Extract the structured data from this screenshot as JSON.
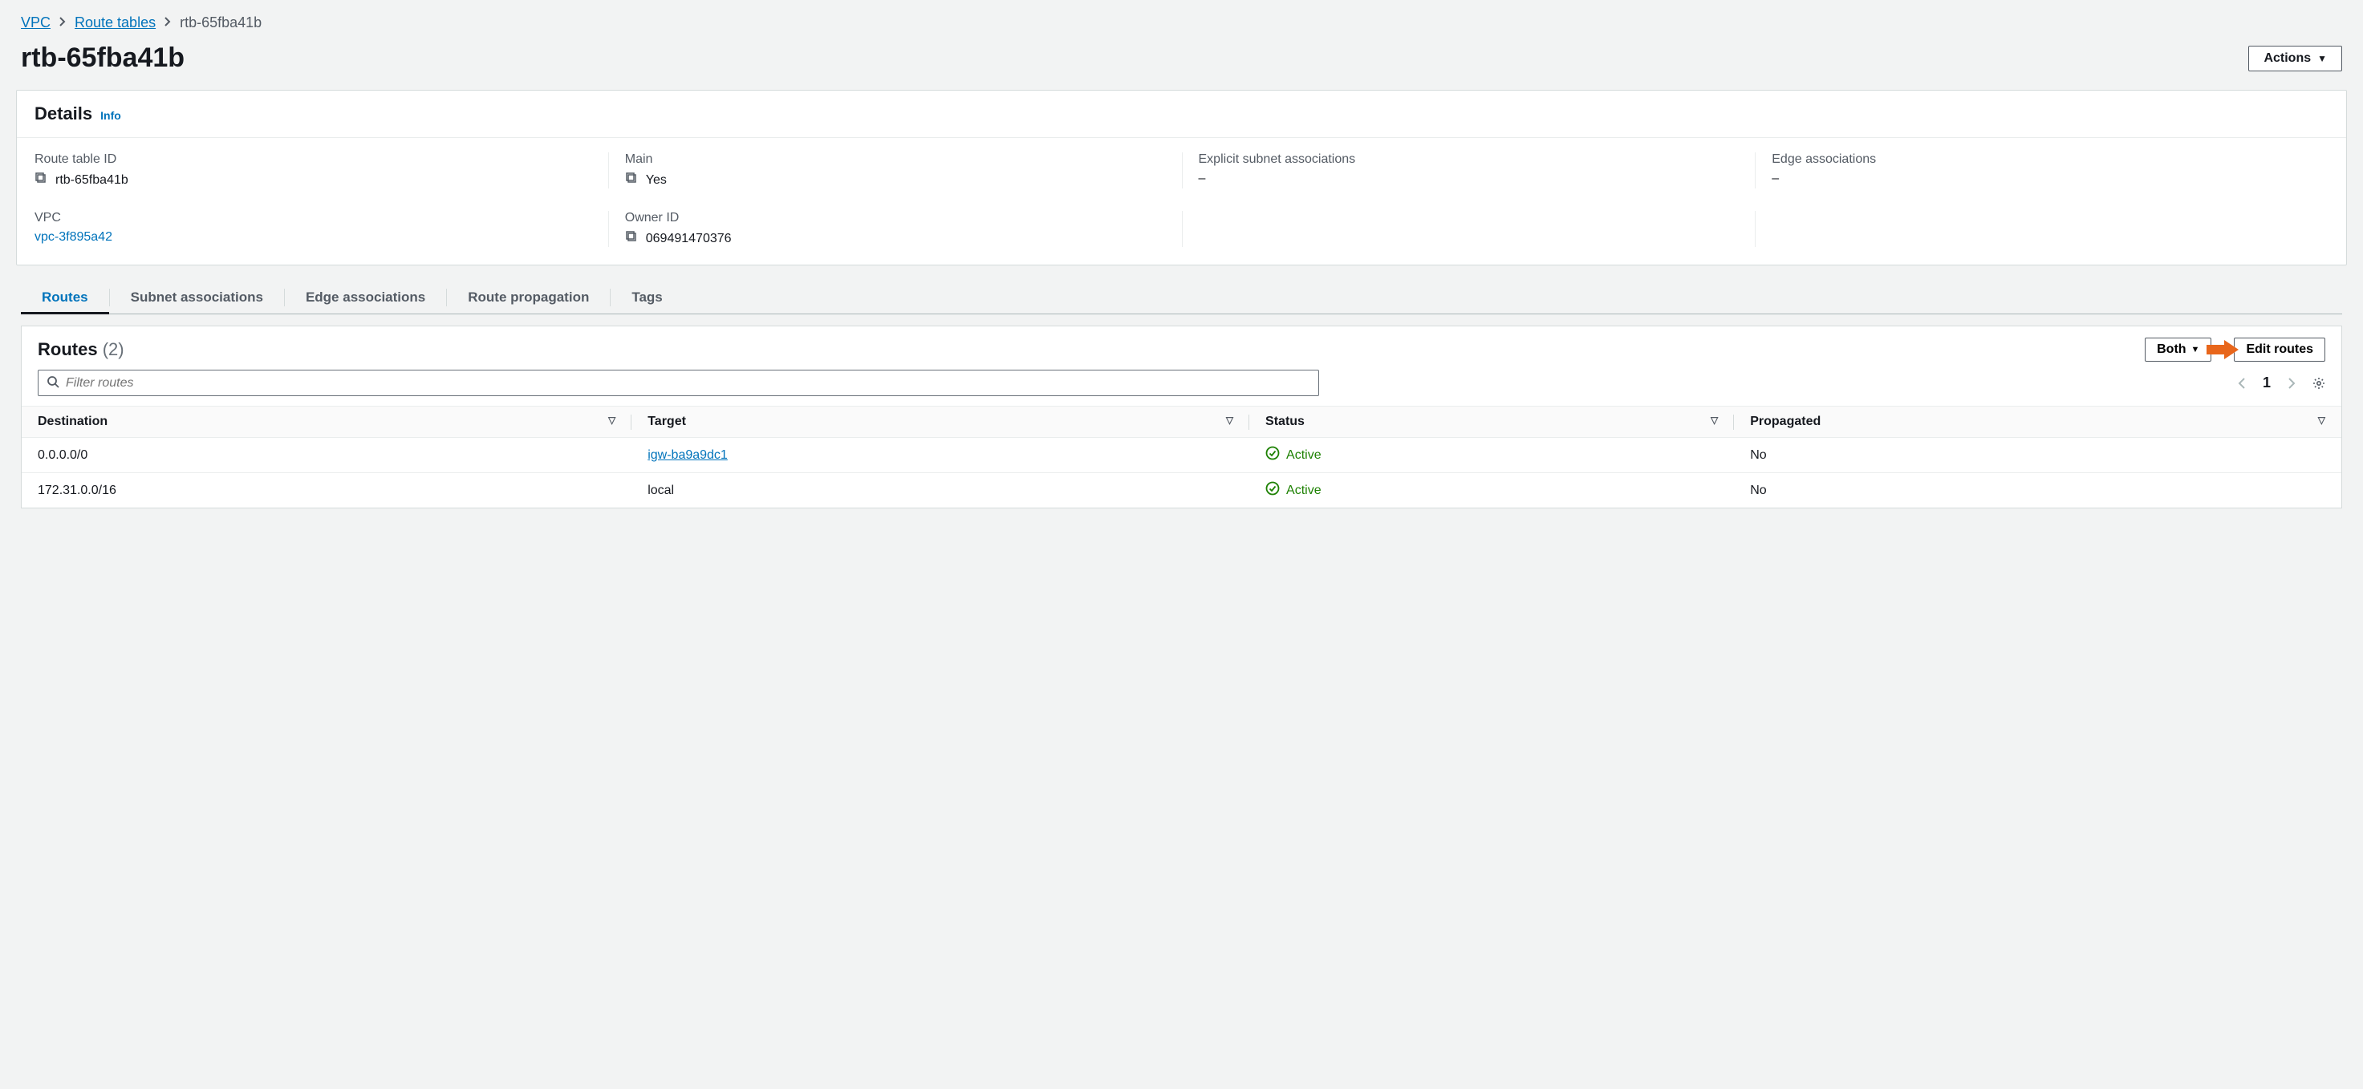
{
  "breadcrumb": {
    "items": [
      "VPC",
      "Route tables"
    ],
    "current": "rtb-65fba41b"
  },
  "page": {
    "title": "rtb-65fba41b",
    "actions_label": "Actions"
  },
  "details": {
    "header": "Details",
    "info_label": "Info",
    "fields": {
      "route_table_id": {
        "label": "Route table ID",
        "value": "rtb-65fba41b",
        "copy": true
      },
      "main": {
        "label": "Main",
        "value": "Yes",
        "copy": true
      },
      "explicit_assoc": {
        "label": "Explicit subnet associations",
        "value": "–"
      },
      "edge_assoc": {
        "label": "Edge associations",
        "value": "–"
      },
      "vpc": {
        "label": "VPC",
        "value": "vpc-3f895a42",
        "link": true
      },
      "owner_id": {
        "label": "Owner ID",
        "value": "069491470376",
        "copy": true
      }
    }
  },
  "tabs": [
    "Routes",
    "Subnet associations",
    "Edge associations",
    "Route propagation",
    "Tags"
  ],
  "routes": {
    "header": "Routes",
    "count_display": "(2)",
    "filter_placeholder": "Filter routes",
    "both_label": "Both",
    "edit_label": "Edit routes",
    "page_number": "1",
    "columns": [
      "Destination",
      "Target",
      "Status",
      "Propagated"
    ],
    "rows": [
      {
        "destination": "0.0.0.0/0",
        "target": "igw-ba9a9dc1",
        "target_link": true,
        "status": "Active",
        "propagated": "No"
      },
      {
        "destination": "172.31.0.0/16",
        "target": "local",
        "target_link": false,
        "status": "Active",
        "propagated": "No"
      }
    ]
  }
}
